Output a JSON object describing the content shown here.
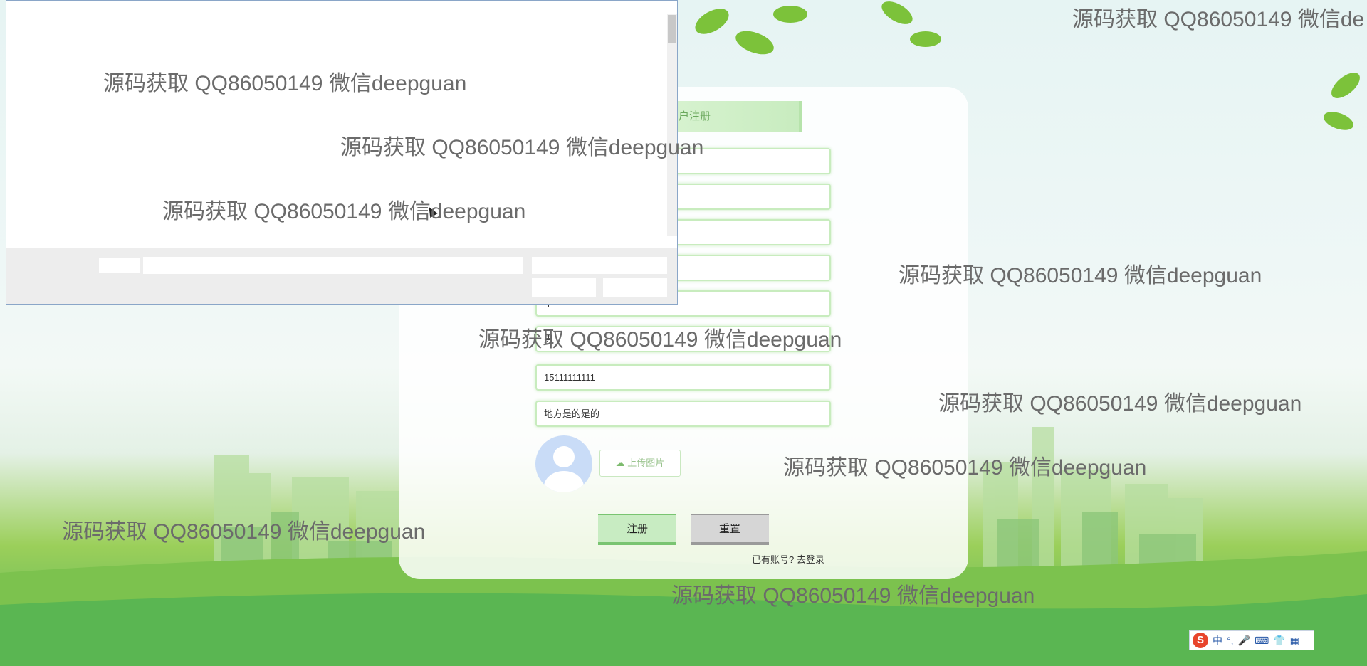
{
  "register": {
    "title": "用户注册",
    "fields": [
      {
        "value": ""
      },
      {
        "value": ""
      },
      {
        "value": ""
      },
      {
        "value": ""
      },
      {
        "value": "宁"
      },
      {
        "value": "男"
      },
      {
        "value": "15111111111"
      },
      {
        "value": "地方是的是的"
      }
    ],
    "upload_label": "上传图片",
    "register_button": "注册",
    "reset_button": "重置",
    "has_account_text": "已有账号?",
    "login_link": "去登录"
  },
  "watermark_text": "源码获取 QQ86050149 微信deepguan",
  "watermark_text_cut": "源码获取 QQ86050149 微信de",
  "ime": {
    "chinese_label": "中",
    "punct_label": "°,"
  },
  "colors": {
    "accent": "#79c471",
    "field_border": "#c8ecbe",
    "reset": "#d6d6d6"
  }
}
